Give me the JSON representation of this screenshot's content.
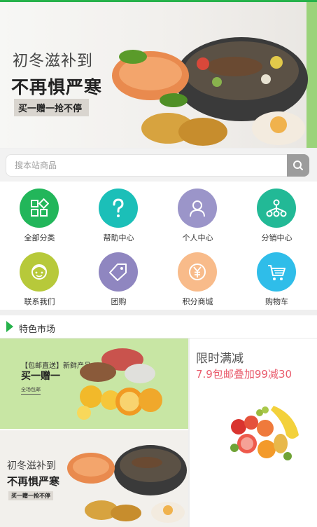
{
  "banner": {
    "line1": "初冬滋补到",
    "line2": "不再惧严寒",
    "line3": "买一赠一抢不停"
  },
  "search": {
    "placeholder": "搜本站商品",
    "icon": "search-icon"
  },
  "nav": {
    "items": [
      {
        "label": "全部分类",
        "icon": "category-grid-icon",
        "color": "#22b65a"
      },
      {
        "label": "帮助中心",
        "icon": "question-icon",
        "color": "#1bbfb8"
      },
      {
        "label": "个人中心",
        "icon": "user-icon",
        "color": "#9b95c9"
      },
      {
        "label": "分销中心",
        "icon": "share-network-icon",
        "color": "#22b996"
      },
      {
        "label": "联系我们",
        "icon": "contact-face-icon",
        "color": "#b7c93a"
      },
      {
        "label": "团购",
        "icon": "tag-icon",
        "color": "#8f86c0"
      },
      {
        "label": "积分商城",
        "icon": "yen-coin-icon",
        "color": "#f8bb8a"
      },
      {
        "label": "购物车",
        "icon": "cart-icon",
        "color": "#2fbde9"
      }
    ]
  },
  "section": {
    "title": "特色市场"
  },
  "market": {
    "card1": {
      "line1": "【包邮直送】新鲜产品",
      "line2": "买一赠一",
      "line3": "全场包邮"
    },
    "card2": {
      "line1": "初冬滋补到",
      "line2": "不再惧严寒",
      "line3": "买一赠一抢不停"
    },
    "promo": {
      "title": "限时满减",
      "subtitle": "7.9包邮叠加99减30"
    }
  },
  "colors": {
    "accent": "#26b24b",
    "promo": "#e95b6c"
  }
}
